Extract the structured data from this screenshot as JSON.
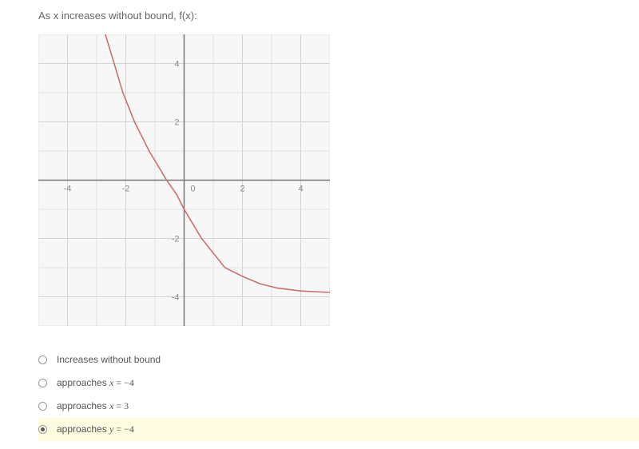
{
  "question": "As x increases without bound, f(x):",
  "chart_data": {
    "type": "line",
    "title": "",
    "xlabel": "",
    "ylabel": "",
    "xlim": [
      -5,
      5
    ],
    "ylim": [
      -5,
      5
    ],
    "x_ticks": [
      -4,
      -2,
      0,
      2,
      4
    ],
    "y_ticks": [
      -4,
      -2,
      2,
      4
    ],
    "grid": true,
    "asymptote_horizontal": -4,
    "curve": [
      {
        "x": -2.9,
        "y": 6.0
      },
      {
        "x": -2.8,
        "y": 5.5
      },
      {
        "x": -2.7,
        "y": 5.0
      },
      {
        "x": -2.55,
        "y": 4.5
      },
      {
        "x": -2.4,
        "y": 4.0
      },
      {
        "x": -2.25,
        "y": 3.5
      },
      {
        "x": -2.1,
        "y": 3.0
      },
      {
        "x": -1.9,
        "y": 2.5
      },
      {
        "x": -1.7,
        "y": 2.0
      },
      {
        "x": -1.45,
        "y": 1.5
      },
      {
        "x": -1.2,
        "y": 1.0
      },
      {
        "x": -0.9,
        "y": 0.5
      },
      {
        "x": -0.6,
        "y": 0.0
      },
      {
        "x": -0.25,
        "y": -0.5
      },
      {
        "x": 0.0,
        "y": -1.0
      },
      {
        "x": 0.3,
        "y": -1.5
      },
      {
        "x": 0.6,
        "y": -2.0
      },
      {
        "x": 1.0,
        "y": -2.5
      },
      {
        "x": 1.4,
        "y": -3.0
      },
      {
        "x": 2.0,
        "y": -3.3
      },
      {
        "x": 2.6,
        "y": -3.55
      },
      {
        "x": 3.2,
        "y": -3.7
      },
      {
        "x": 4.0,
        "y": -3.8
      },
      {
        "x": 5.0,
        "y": -3.85
      }
    ]
  },
  "options": [
    {
      "text_pre": "Increases without bound",
      "var": "",
      "eq": "",
      "val": "",
      "selected": false
    },
    {
      "text_pre": "approaches ",
      "var": "x",
      "eq": "=",
      "val": "−4",
      "selected": false
    },
    {
      "text_pre": "approaches ",
      "var": "x",
      "eq": "=",
      "val": "3",
      "selected": false
    },
    {
      "text_pre": "approaches ",
      "var": "y",
      "eq": "=",
      "val": "−4",
      "selected": true
    }
  ],
  "tick_labels": {
    "xm4": "-4",
    "xm2": "-2",
    "x0": "0",
    "x2": "2",
    "x4": "4",
    "ym4": "-4",
    "ym2": "-2",
    "y2": "2",
    "y4": "4"
  }
}
